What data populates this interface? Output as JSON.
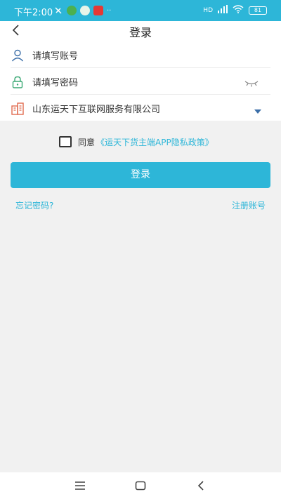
{
  "status_bar": {
    "time": "下午2:00",
    "signal": "HD",
    "battery": "81"
  },
  "header": {
    "title": "登录",
    "back_icon": "chevron-left-icon"
  },
  "form": {
    "account_placeholder": "请填写账号",
    "password_placeholder": "请填写密码",
    "company_selected": "山东运天下互联网服务有限公司"
  },
  "agreement": {
    "label": "同意",
    "link_text": "《运天下货主端APP隐私政策》"
  },
  "actions": {
    "login_label": "登录",
    "forgot_label": "忘记密码?",
    "register_label": "注册账号"
  },
  "colors": {
    "accent": "#2db6d8",
    "icon_blue": "#3b6ea8",
    "icon_green": "#3aa874",
    "icon_red": "#e06b50"
  }
}
